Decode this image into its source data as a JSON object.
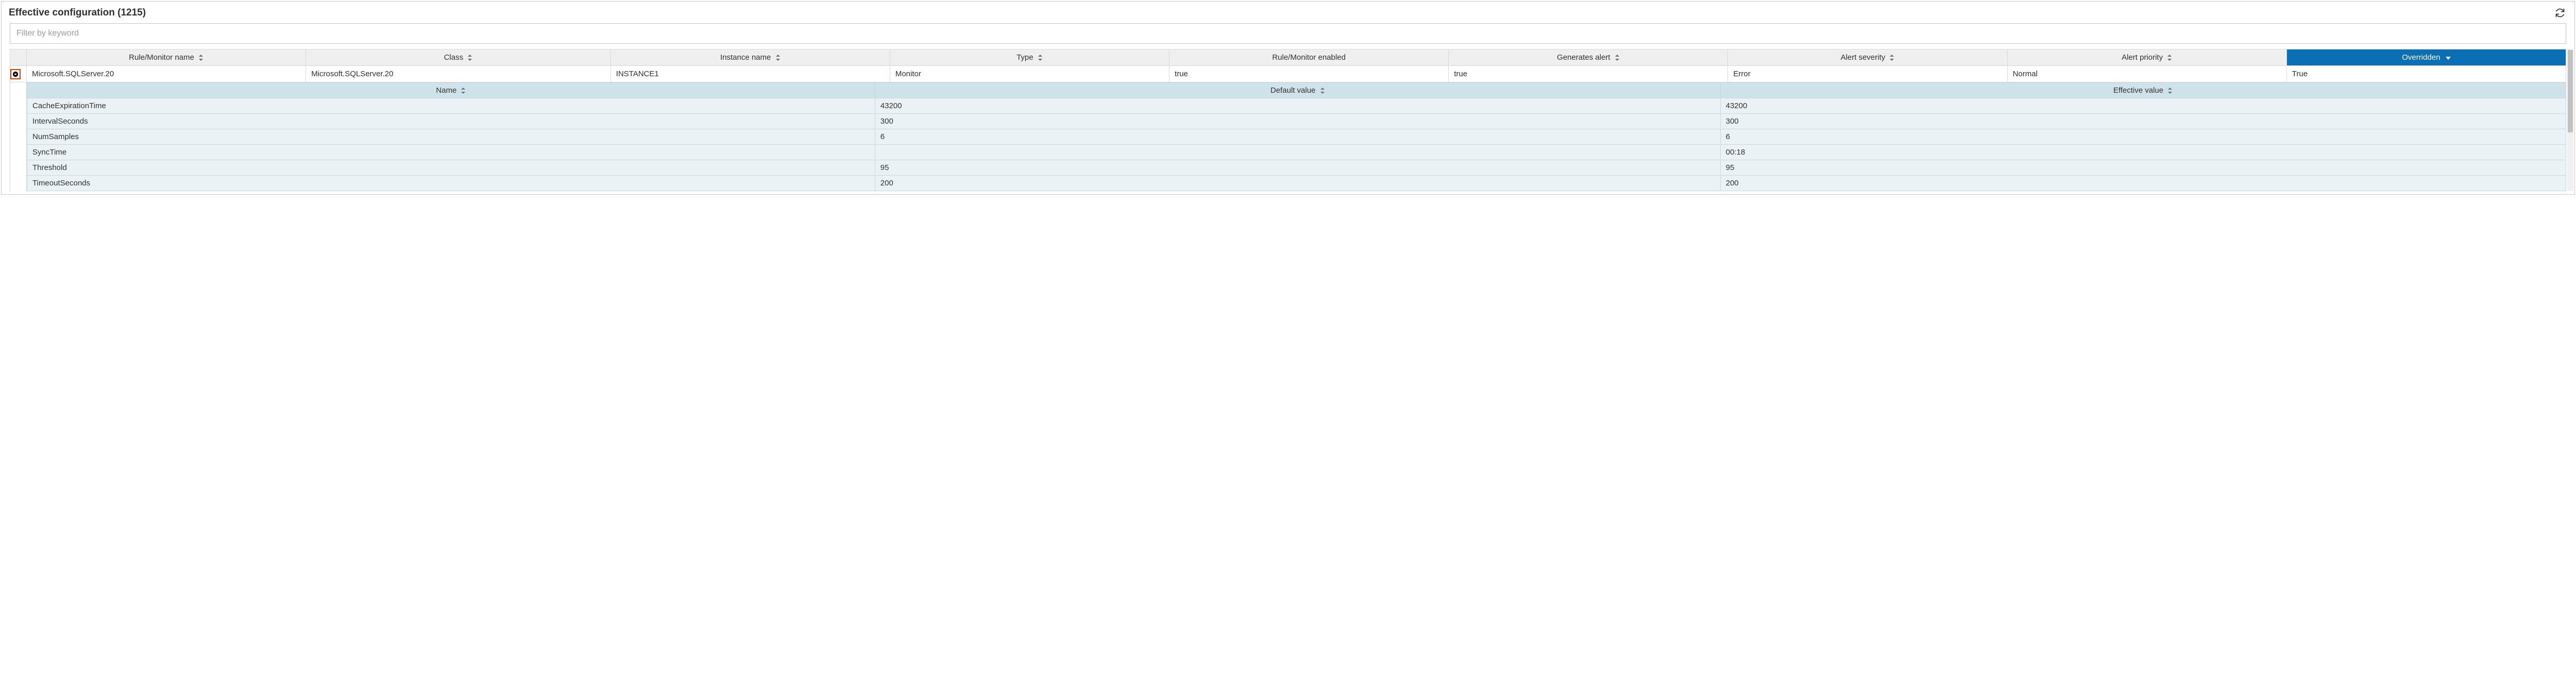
{
  "panel": {
    "title": "Effective configuration (1215)"
  },
  "filter": {
    "placeholder": "Filter by keyword",
    "value": ""
  },
  "columns": {
    "rule_name": "Rule/Monitor name",
    "class": "Class",
    "instance": "Instance name",
    "type": "Type",
    "enabled": "Rule/Monitor enabled",
    "generates_alert": "Generates alert",
    "severity": "Alert severity",
    "priority": "Alert priority",
    "overridden": "Overridden"
  },
  "row": {
    "rule_name": "Microsoft.SQLServer.20",
    "class": "Microsoft.SQLServer.20",
    "instance": "INSTANCE1",
    "type": "Monitor",
    "enabled": "true",
    "generates_alert": "true",
    "severity": "Error",
    "priority": "Normal",
    "overridden": "True"
  },
  "detail": {
    "columns": {
      "name": "Name",
      "default": "Default value",
      "effective": "Effective value"
    },
    "rows": [
      {
        "name": "CacheExpirationTime",
        "default": "43200",
        "effective": "43200"
      },
      {
        "name": "IntervalSeconds",
        "default": "300",
        "effective": "300"
      },
      {
        "name": "NumSamples",
        "default": "6",
        "effective": "6"
      },
      {
        "name": "SyncTime",
        "default": "",
        "effective": "00:18"
      },
      {
        "name": "Threshold",
        "default": "95",
        "effective": "95"
      },
      {
        "name": "TimeoutSeconds",
        "default": "200",
        "effective": "200"
      }
    ]
  }
}
